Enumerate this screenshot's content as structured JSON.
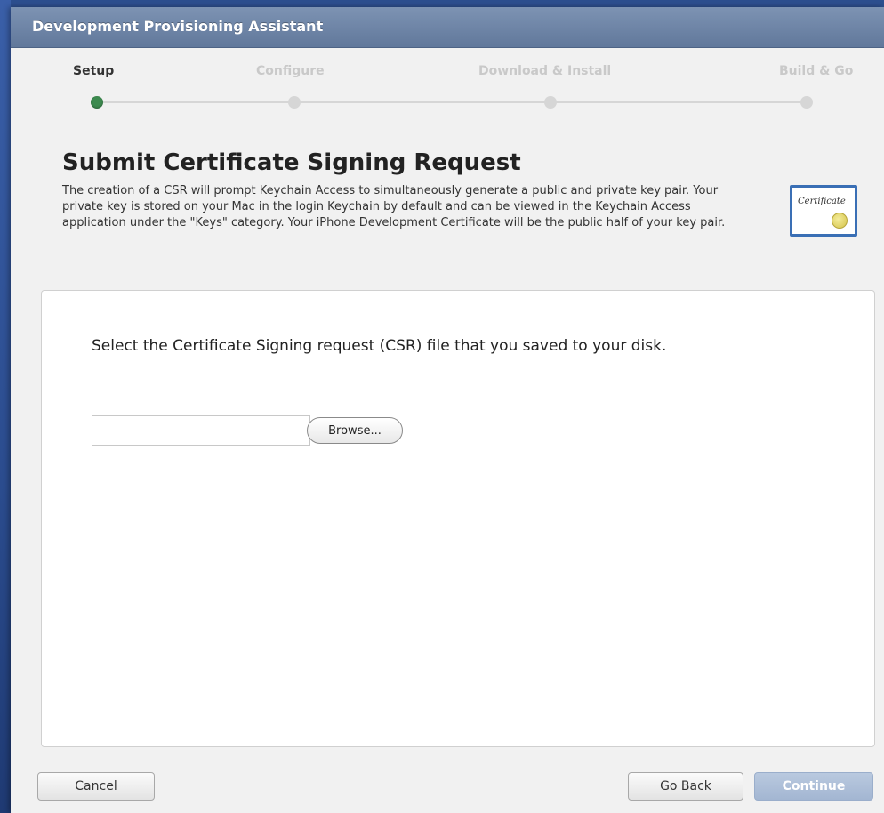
{
  "window": {
    "title": "Development Provisioning Assistant"
  },
  "steps": [
    {
      "label": "Setup",
      "active": true
    },
    {
      "label": "Configure",
      "active": false
    },
    {
      "label": "Download & Install",
      "active": false
    },
    {
      "label": "Build & Go",
      "active": false
    }
  ],
  "content": {
    "heading": "Submit Certificate Signing Request",
    "description": "The creation of a CSR will prompt Keychain Access to simultaneously generate a public and private key pair. Your private key is stored on your Mac in the login Keychain by default and can be viewed in the Keychain Access application under the \"Keys\" category. Your iPhone Development Certificate will be the public half of your key pair.",
    "certificate_icon_text": "Certificate",
    "instruction": "Select the Certificate Signing request (CSR) file that you saved to your disk.",
    "file_input_value": "",
    "browse_label": "Browse..."
  },
  "footer": {
    "cancel_label": "Cancel",
    "back_label": "Go Back",
    "continue_label": "Continue"
  },
  "colors": {
    "active_step": "#3d8a4f",
    "titlebar": "#6f86a8",
    "continue_button": "#a3b6d2"
  },
  "icons": [
    "certificate-icon"
  ]
}
